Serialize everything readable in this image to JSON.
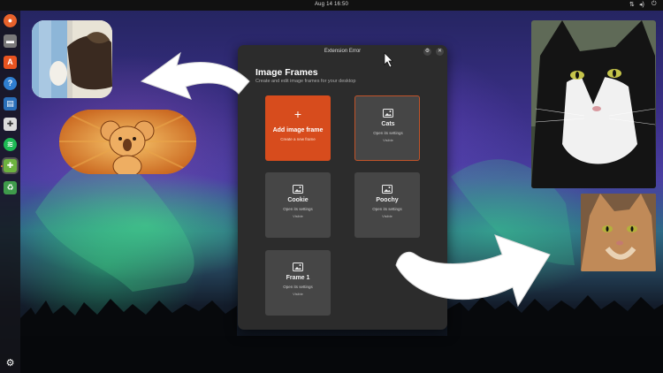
{
  "topbar": {
    "clock": "Aug 14  16:50"
  },
  "dock": {
    "apps": [
      {
        "name": "firefox",
        "color": "#e8622b",
        "glyph": "●"
      },
      {
        "name": "files",
        "color": "#7a7a7a",
        "glyph": "▬"
      },
      {
        "name": "software",
        "color": "#e95420",
        "glyph": "A"
      },
      {
        "name": "help",
        "color": "#2f7fd1",
        "glyph": "?"
      },
      {
        "name": "writer",
        "color": "#2a6fb9",
        "glyph": "▤"
      },
      {
        "name": "extension-manager",
        "color": "#dddddd",
        "glyph": "✚"
      },
      {
        "name": "spotify",
        "color": "#1db954",
        "glyph": "≋"
      },
      {
        "name": "extensions",
        "color": "#6db33f",
        "glyph": "✚"
      },
      {
        "name": "trash",
        "color": "#3f9b4b",
        "glyph": "♻"
      }
    ]
  },
  "window": {
    "title": "Extension Error",
    "heading": "Image Frames",
    "subheading": "Create and edit image frames for your desktop",
    "add_tile": {
      "plus": "+",
      "title": "Add image frame",
      "subtitle": "Create a new frame"
    },
    "frames": [
      {
        "title": "Cats",
        "subtitle": "Open its settings",
        "badge": "Visible"
      },
      {
        "title": "Cookie",
        "subtitle": "Open its settings",
        "badge": "Visible"
      },
      {
        "title": "Poochy",
        "subtitle": "Open its settings",
        "badge": "Visible"
      },
      {
        "title": "Frame 1",
        "subtitle": "Open its settings",
        "badge": "Visible"
      }
    ]
  },
  "colors": {
    "accent": "#d74c1d",
    "window_bg": "#2c2c2c",
    "tile_bg": "#464646"
  }
}
